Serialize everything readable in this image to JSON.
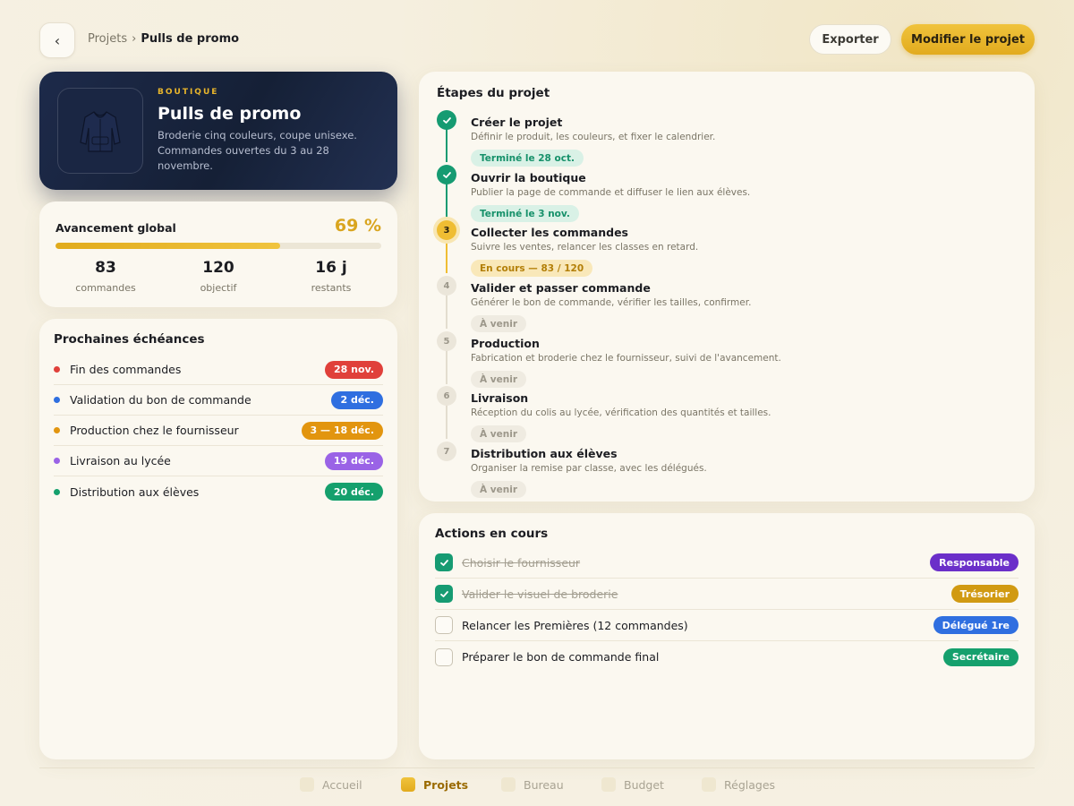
{
  "header": {
    "back_icon": "‹",
    "breadcrumb_parent": "Projets",
    "breadcrumb_sep": "›",
    "breadcrumb_current": "Pulls de promo",
    "export_label": "Exporter",
    "edit_label": "Modifier le projet"
  },
  "hero": {
    "tag": "BOUTIQUE",
    "title": "Pulls de promo",
    "description": "Broderie cinq couleurs, coupe unisexe. Commandes ouvertes du 3 au 28 novembre.",
    "image_icon": "hoodie-icon"
  },
  "progress": {
    "label": "Avancement global",
    "percent_text": "69 %",
    "percent": 69,
    "stats": [
      {
        "value": "83",
        "label": "commandes"
      },
      {
        "value": "120",
        "label": "objectif"
      },
      {
        "value": "16 j",
        "label": "restants"
      }
    ]
  },
  "deadlines": {
    "title": "Prochaines échéances",
    "items": [
      {
        "label": "Fin des commandes",
        "date": "28 nov.",
        "color": "#e0403a"
      },
      {
        "label": "Validation du bon de commande",
        "date": "2 déc.",
        "color": "#2f6fe0"
      },
      {
        "label": "Production chez le fournisseur",
        "date": "3 — 18 déc.",
        "color": "#e2950f"
      },
      {
        "label": "Livraison au lycée",
        "date": "19 déc.",
        "color": "#9a63e6"
      },
      {
        "label": "Distribution aux élèves",
        "date": "20 déc.",
        "color": "#15a06d"
      }
    ]
  },
  "steps": {
    "title": "Étapes du projet",
    "items": [
      {
        "num": "1",
        "name": "Créer le projet",
        "desc": "Définir le produit, les couleurs, et fixer le calendrier.",
        "status": "Terminé le 28 oct.",
        "state": "done"
      },
      {
        "num": "2",
        "name": "Ouvrir la boutique",
        "desc": "Publier la page de commande et diffuser le lien aux élèves.",
        "status": "Terminé le 3 nov.",
        "state": "done"
      },
      {
        "num": "3",
        "name": "Collecter les commandes",
        "desc": "Suivre les ventes, relancer les classes en retard.",
        "status": "En cours — 83 / 120",
        "state": "current"
      },
      {
        "num": "4",
        "name": "Valider et passer commande",
        "desc": "Générer le bon de commande, vérifier les tailles, confirmer.",
        "status": "À venir",
        "state": "todo"
      },
      {
        "num": "5",
        "name": "Production",
        "desc": "Fabrication et broderie chez le fournisseur, suivi de l'avancement.",
        "status": "À venir",
        "state": "todo"
      },
      {
        "num": "6",
        "name": "Livraison",
        "desc": "Réception du colis au lycée, vérification des quantités et tailles.",
        "status": "À venir",
        "state": "todo"
      },
      {
        "num": "7",
        "name": "Distribution aux élèves",
        "desc": "Organiser la remise par classe, avec les délégués.",
        "status": "À venir",
        "state": "todo"
      }
    ]
  },
  "actions": {
    "title": "Actions en cours",
    "items": [
      {
        "label": "Choisir le fournisseur",
        "done": true,
        "role": "Responsable",
        "color": "#6b2fc9"
      },
      {
        "label": "Valider le visuel de broderie",
        "done": true,
        "role": "Trésorier",
        "color": "#d19a12"
      },
      {
        "label": "Relancer les Premières (12 commandes)",
        "done": false,
        "role": "Délégué 1re",
        "color": "#2f6fe0"
      },
      {
        "label": "Préparer le bon de commande final",
        "done": false,
        "role": "Secrétaire",
        "color": "#15a06d"
      }
    ]
  },
  "nav": {
    "items": [
      {
        "label": "Accueil",
        "active": false
      },
      {
        "label": "Projets",
        "active": true
      },
      {
        "label": "Bureau",
        "active": false
      },
      {
        "label": "Budget",
        "active": false
      },
      {
        "label": "Réglages",
        "active": false
      }
    ]
  }
}
